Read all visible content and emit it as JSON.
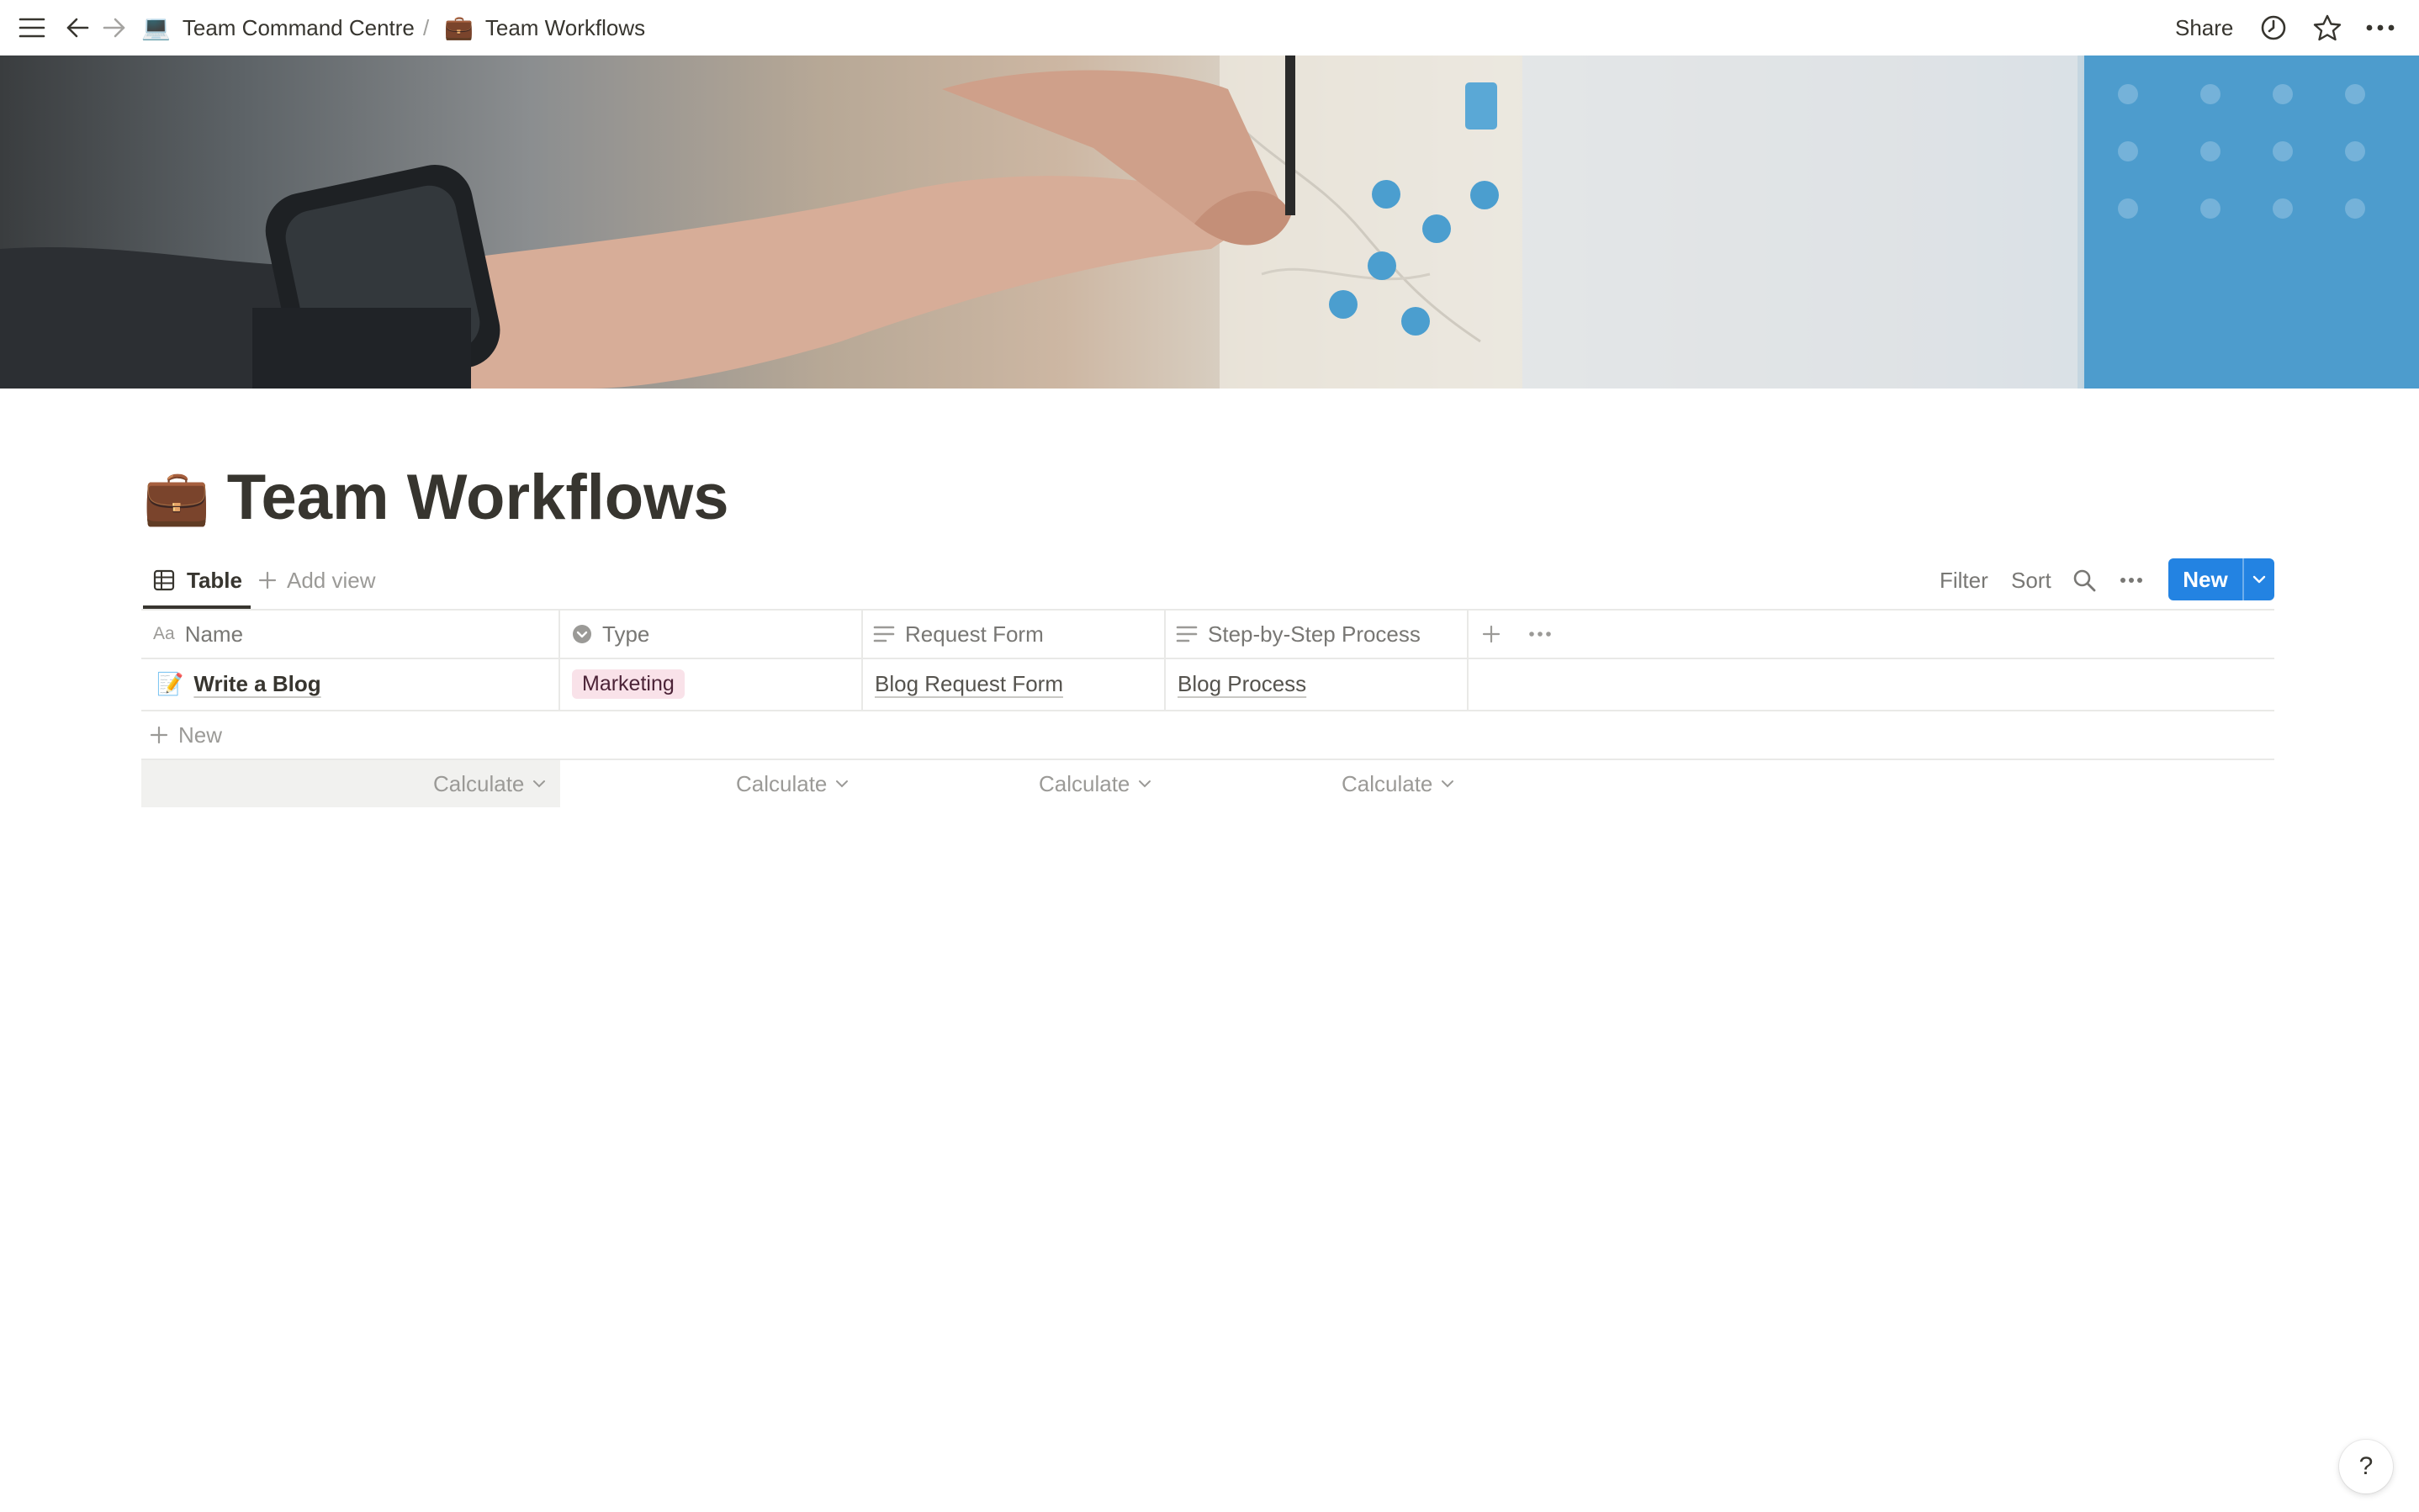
{
  "breadcrumb": {
    "items": [
      {
        "emoji": "💻",
        "label": "Team Command Centre"
      },
      {
        "emoji": "💼",
        "label": "Team Workflows"
      }
    ],
    "separator": "/"
  },
  "topbar": {
    "share_label": "Share"
  },
  "page": {
    "emoji": "💼",
    "title": "Team Workflows"
  },
  "views": {
    "active_tab": "Table",
    "add_view_label": "Add view"
  },
  "toolbar": {
    "filter_label": "Filter",
    "sort_label": "Sort",
    "new_label": "New"
  },
  "table": {
    "columns": [
      {
        "label": "Name",
        "icon": "title-aa-icon"
      },
      {
        "label": "Type",
        "icon": "select-icon"
      },
      {
        "label": "Request Form",
        "icon": "text-lines-icon"
      },
      {
        "label": "Step-by-Step Process",
        "icon": "text-lines-icon"
      }
    ],
    "rows": [
      {
        "emoji": "📝",
        "name": "Write a Blog",
        "type": "Marketing",
        "request_form": "Blog Request Form",
        "process": "Blog Process"
      }
    ],
    "new_row_label": "New",
    "calculate_label": "Calculate"
  },
  "help": {
    "label": "?"
  },
  "colors": {
    "accent": "#2383e2",
    "tag_bg": "#f9e2e9",
    "text": "#37352f",
    "muted": "#9b9a97"
  }
}
